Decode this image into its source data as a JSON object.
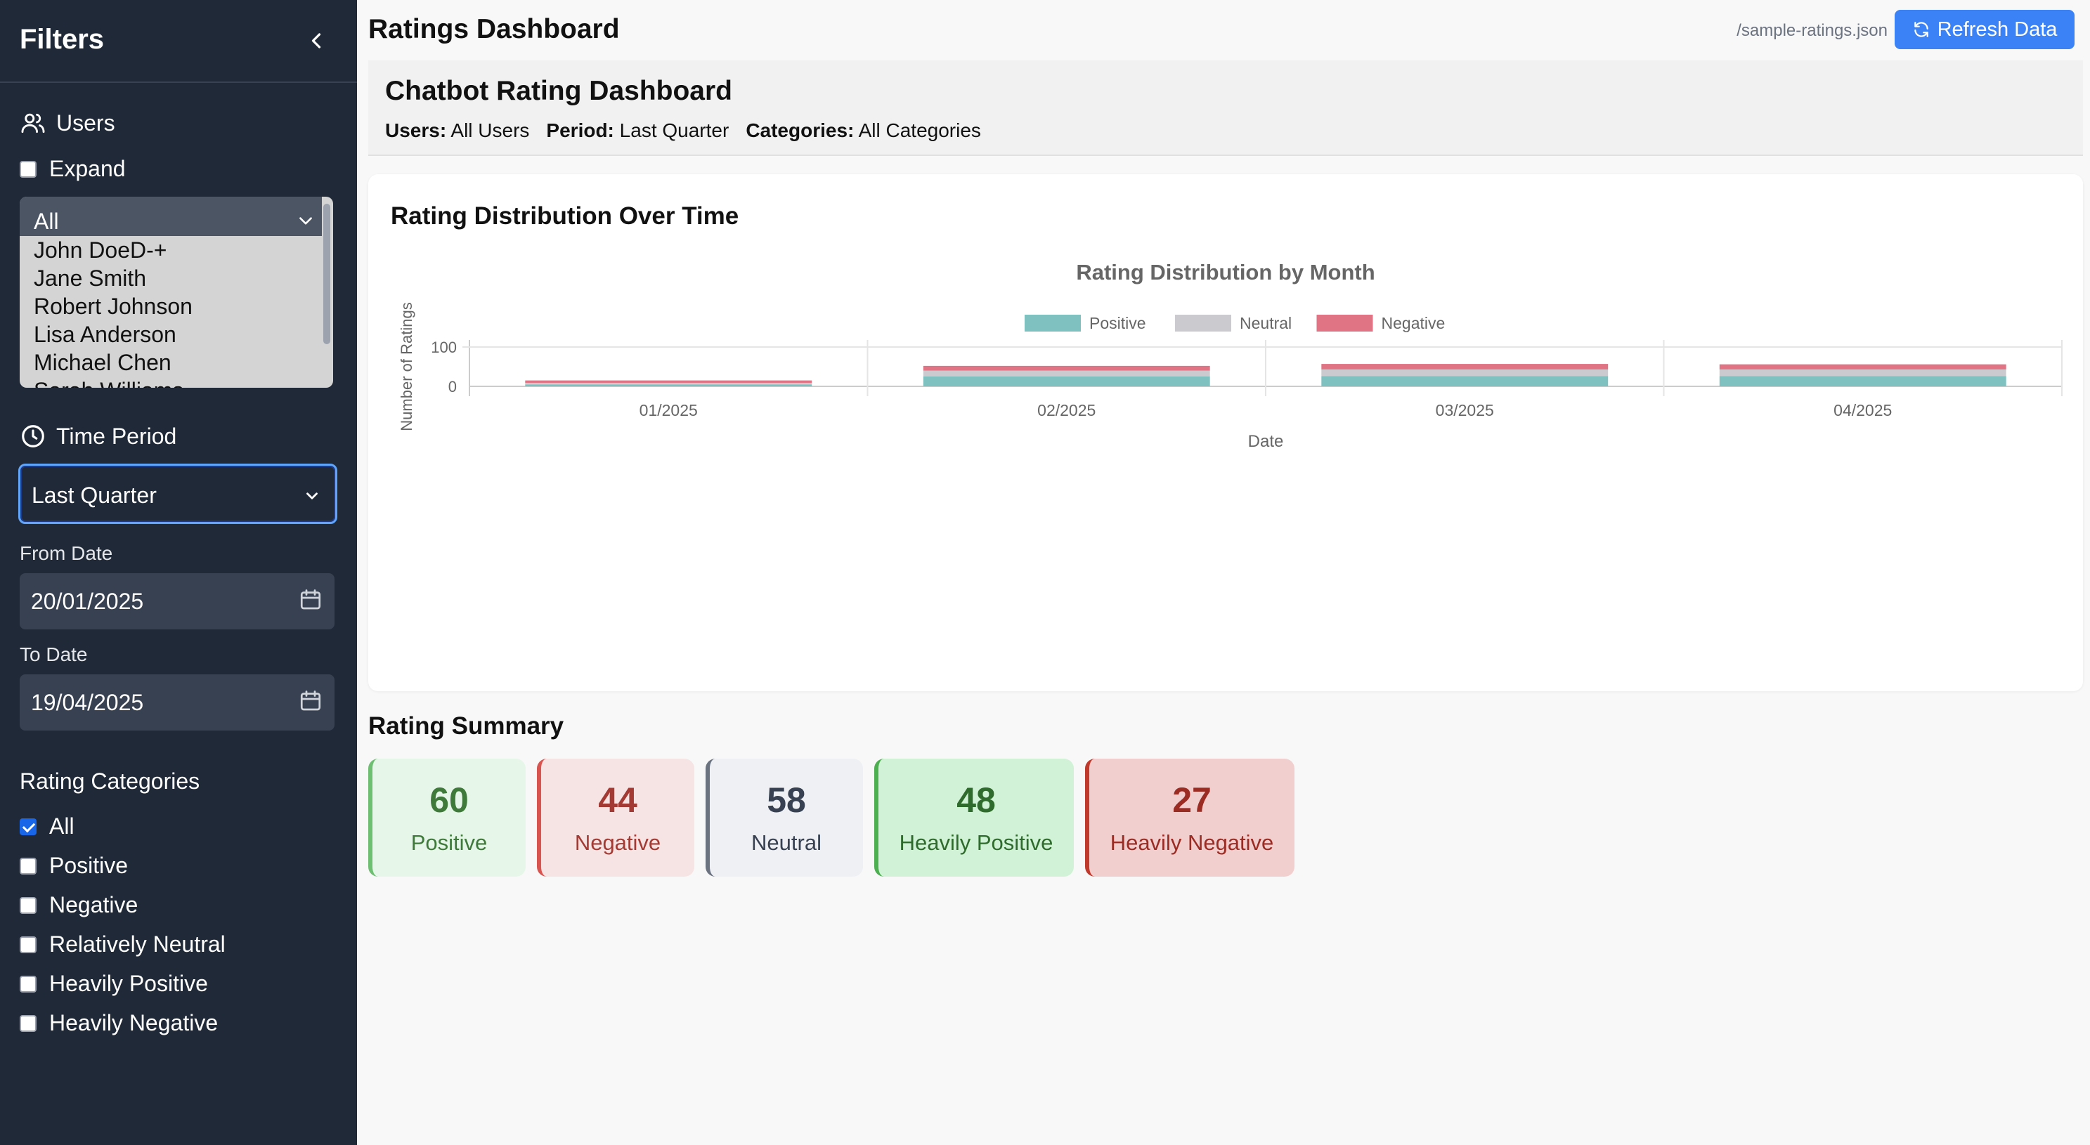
{
  "sidebar": {
    "title": "Filters",
    "users": {
      "label": "Users",
      "expand_label": "Expand",
      "options": [
        "All",
        "John DoeD-+",
        "Jane Smith",
        "Robert Johnson",
        "Lisa Anderson",
        "Michael Chen",
        "Sarah Williams"
      ]
    },
    "time_period": {
      "label": "Time Period",
      "selected": "Last Quarter",
      "from_label": "From Date",
      "from_value": "20/01/2025",
      "to_label": "To Date",
      "to_value": "19/04/2025"
    },
    "categories": {
      "label": "Rating Categories",
      "items": [
        {
          "label": "All",
          "checked": true
        },
        {
          "label": "Positive",
          "checked": false
        },
        {
          "label": "Negative",
          "checked": false
        },
        {
          "label": "Relatively Neutral",
          "checked": false
        },
        {
          "label": "Heavily Positive",
          "checked": false
        },
        {
          "label": "Heavily Negative",
          "checked": false
        }
      ]
    }
  },
  "header": {
    "title": "Ratings Dashboard",
    "source": "/sample-ratings.json",
    "refresh_label": "Refresh Data"
  },
  "info": {
    "title": "Chatbot Rating Dashboard",
    "users_key": "Users:",
    "users_val": "All Users",
    "period_key": "Period:",
    "period_val": "Last Quarter",
    "categories_key": "Categories:",
    "categories_val": "All Categories"
  },
  "chart_section": {
    "title": "Rating Distribution Over Time"
  },
  "chart_data": {
    "type": "bar",
    "stacked": true,
    "title": "Rating Distribution by Month",
    "xlabel": "Date",
    "ylabel": "Number of Ratings",
    "ylim": [
      0,
      100
    ],
    "yticks": [
      0,
      100
    ],
    "legend_position": "top",
    "categories": [
      "01/2025",
      "02/2025",
      "03/2025",
      "04/2025"
    ],
    "series": [
      {
        "name": "Positive",
        "color": "#7fc0c0",
        "values": [
          5,
          25,
          26,
          26
        ]
      },
      {
        "name": "Neutral",
        "color": "#cbcbcf",
        "values": [
          4,
          15,
          17,
          17
        ]
      },
      {
        "name": "Negative",
        "color": "#e07384",
        "values": [
          6,
          12,
          14,
          13
        ]
      }
    ]
  },
  "summary": {
    "title": "Rating Summary",
    "cards": [
      {
        "value": "60",
        "label": "Positive",
        "bg": "#e6f6e9",
        "border": "#6fbf73",
        "text": "#3f7a3a"
      },
      {
        "value": "44",
        "label": "Negative",
        "bg": "#f6e4e4",
        "border": "#d9534f",
        "text": "#a33a33"
      },
      {
        "value": "58",
        "label": "Neutral",
        "bg": "#eff0f3",
        "border": "#6b7280",
        "text": "#374151"
      },
      {
        "value": "48",
        "label": "Heavily Positive",
        "bg": "#d1f2d6",
        "border": "#4caf50",
        "text": "#2f6b2c"
      },
      {
        "value": "27",
        "label": "Heavily Negative",
        "bg": "#f2cfcf",
        "border": "#c0392b",
        "text": "#9b2c24"
      }
    ]
  }
}
